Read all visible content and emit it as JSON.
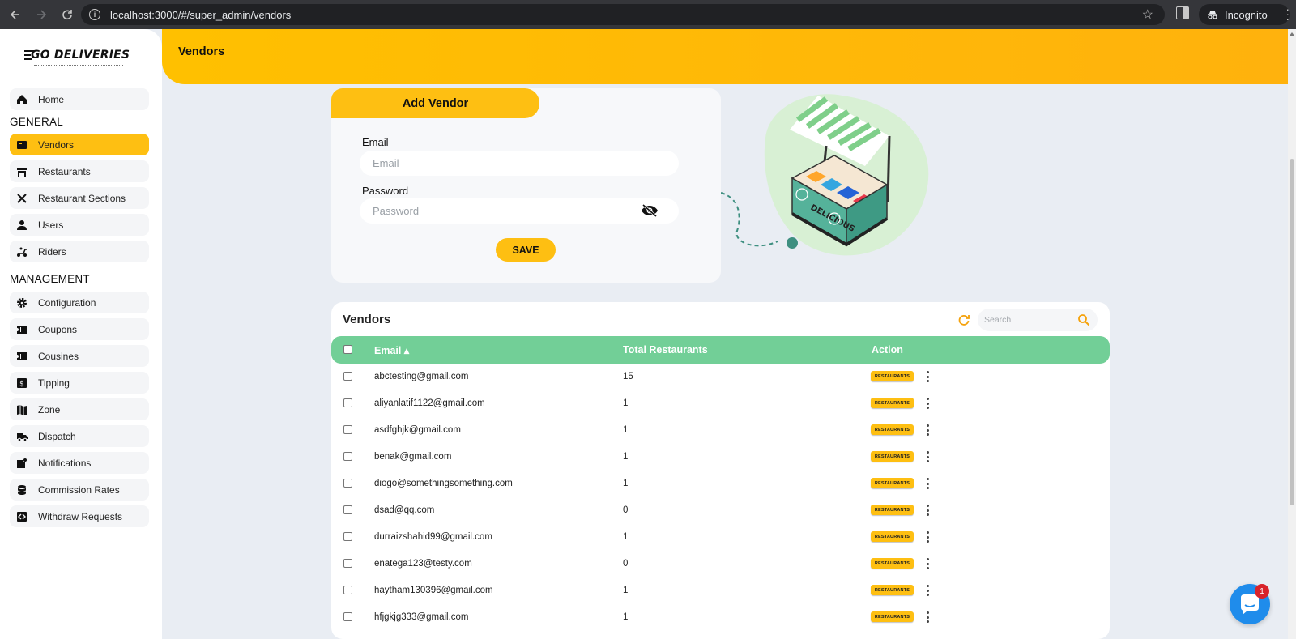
{
  "browser": {
    "url": "localhost:3000/#/super_admin/vendors",
    "incognito_label": "Incognito"
  },
  "brand": {
    "logo_text": "GO DELIVERIES"
  },
  "header": {
    "title": "Vendors"
  },
  "sidebar": {
    "home": "Home",
    "section_general": "GENERAL",
    "general_items": [
      {
        "label": "Vendors",
        "icon": "vendors-icon",
        "active": true
      },
      {
        "label": "Restaurants",
        "icon": "store-icon"
      },
      {
        "label": "Restaurant Sections",
        "icon": "utensils-icon"
      },
      {
        "label": "Users",
        "icon": "user-icon"
      },
      {
        "label": "Riders",
        "icon": "scooter-icon"
      }
    ],
    "section_management": "MANAGEMENT",
    "management_items": [
      {
        "label": "Configuration",
        "icon": "gear-icon"
      },
      {
        "label": "Coupons",
        "icon": "ticket-icon"
      },
      {
        "label": "Cousines",
        "icon": "ticket-icon"
      },
      {
        "label": "Tipping",
        "icon": "money-icon"
      },
      {
        "label": "Zone",
        "icon": "map-icon"
      },
      {
        "label": "Dispatch",
        "icon": "truck-icon"
      },
      {
        "label": "Notifications",
        "icon": "bell-icon"
      },
      {
        "label": "Commission Rates",
        "icon": "database-icon"
      },
      {
        "label": "Withdraw Requests",
        "icon": "withdraw-icon"
      }
    ]
  },
  "add_vendor": {
    "title": "Add Vendor",
    "email_label": "Email",
    "email_placeholder": "Email",
    "email_value": "",
    "password_label": "Password",
    "password_placeholder": "Password",
    "password_value": "",
    "save_label": "SAVE"
  },
  "vendors_table": {
    "title": "Vendors",
    "search_placeholder": "Search",
    "columns": {
      "email": "Email ▴",
      "total_restaurants": "Total Restaurants",
      "action": "Action"
    },
    "action_badge": "RESTAURANTS",
    "rows": [
      {
        "email": "abctesting@gmail.com",
        "total": "15"
      },
      {
        "email": "aliyanlatif1122@gmail.com",
        "total": "1"
      },
      {
        "email": "asdfghjk@gmail.com",
        "total": "1"
      },
      {
        "email": "benak@gmail.com",
        "total": "1"
      },
      {
        "email": "diogo@somethingsomething.com",
        "total": "1"
      },
      {
        "email": "dsad@qq.com",
        "total": "0"
      },
      {
        "email": "durraizshahid99@gmail.com",
        "total": "1"
      },
      {
        "email": "enatega123@testy.com",
        "total": "0"
      },
      {
        "email": "haytham130396@gmail.com",
        "total": "1"
      },
      {
        "email": "hfjgkjg333@gmail.com",
        "total": "1"
      }
    ]
  },
  "chat": {
    "unread_count": "1"
  },
  "colors": {
    "accent": "#febf12",
    "header_start": "#ffc000",
    "table_header": "#72cf97",
    "background": "#e9edf3",
    "chat": "#1f8ceb",
    "badge_red": "#d8232a"
  }
}
